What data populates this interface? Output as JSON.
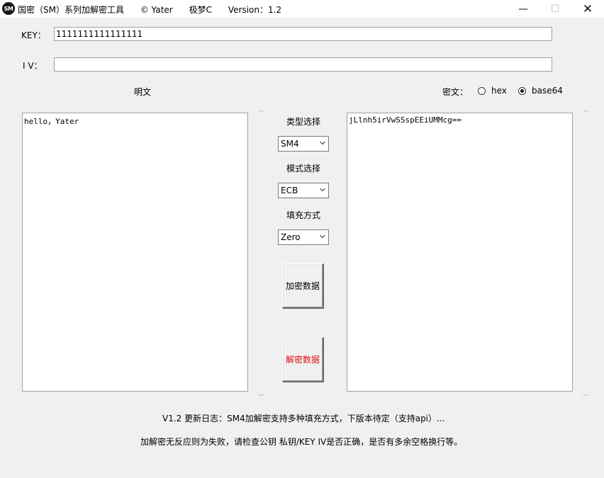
{
  "window": {
    "icon_text": "SM",
    "title": "国密（SM）系列加解密工具      © Yater      极梦C      Version：1.2",
    "minimize": "—",
    "maximize": "☐",
    "close": "✕"
  },
  "key": {
    "label": "KEY：",
    "value": "1111111111111111"
  },
  "iv": {
    "label": "I V：",
    "value": ""
  },
  "plaintext": {
    "label": "明文",
    "value": "hello，Yater"
  },
  "ciphertext": {
    "label": "密文：",
    "value": "jLlnh5irVwSSspEEiUMMcg==",
    "formats": [
      {
        "label": "hex",
        "checked": false
      },
      {
        "label": "base64",
        "checked": true
      }
    ]
  },
  "controls": {
    "type_label": "类型选择",
    "type_value": "SM4",
    "mode_label": "模式选择",
    "mode_value": "ECB",
    "padding_label": "填充方式",
    "padding_value": "Zero",
    "encrypt_button": "加密数据",
    "decrypt_button": "解密数据"
  },
  "footer": {
    "changelog": "V1.2 更新日志：SM4加解密支持多种填充方式，下版本待定（支持api）...",
    "hint": "加解密无反应则为失败，请检查公钥 私钥/KEY IV是否正确，是否有多余空格换行等。"
  },
  "colors": {
    "decrypt_text": "#e01010",
    "background": "#f0f0f0"
  }
}
